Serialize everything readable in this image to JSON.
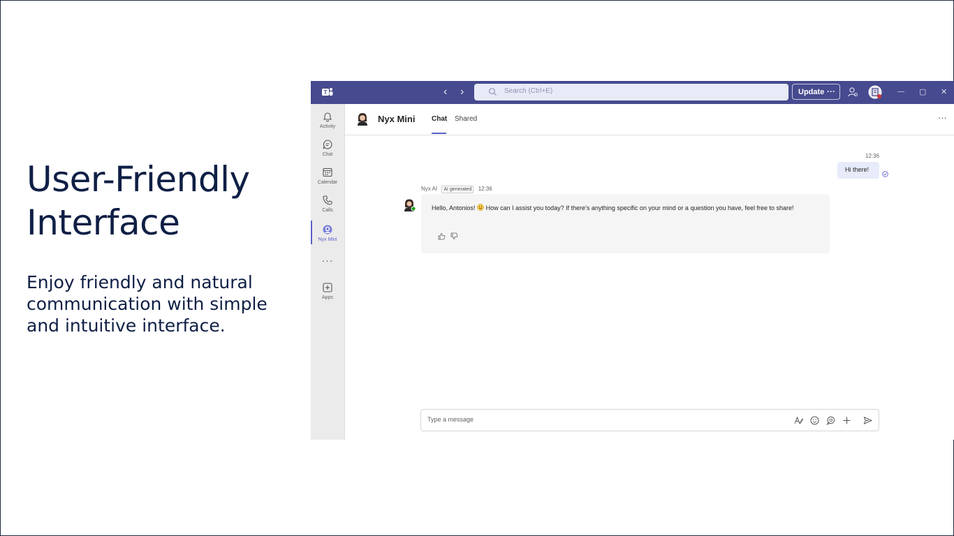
{
  "slide": {
    "title": "User-Friendly Interface",
    "subtitle": "Enjoy friendly and natural communication with simple and intuitive interface."
  },
  "titlebar": {
    "search_placeholder": "Search (Ctrl+E)",
    "update_label": "Update",
    "update_more": "···",
    "back": "‹",
    "forward": "›",
    "minimize": "—",
    "maximize": "▢",
    "close": "✕"
  },
  "rail": {
    "items": [
      {
        "label": "Activity",
        "icon": "bell-icon"
      },
      {
        "label": "Chat",
        "icon": "chat-icon"
      },
      {
        "label": "Calendar",
        "icon": "calendar-icon"
      },
      {
        "label": "Calls",
        "icon": "phone-icon"
      },
      {
        "label": "Nyx Mini",
        "icon": "nyx-mini-icon"
      },
      {
        "label": "Apps",
        "icon": "apps-icon"
      }
    ],
    "more": "···"
  },
  "chat": {
    "name": "Nyx Mini",
    "tabs": [
      {
        "label": "Chat",
        "active": true
      },
      {
        "label": "Shared",
        "active": false
      }
    ],
    "more": "···"
  },
  "messages": {
    "user": {
      "time": "12:36",
      "text": "Hi there!"
    },
    "bot": {
      "sender": "Nyx AI",
      "badge": "AI generated",
      "time": "12:36",
      "text_before": "Hello, Antonios!",
      "text_after": "How can I assist you today? If there's anything specific on your mind or a question you have, feel free to share!"
    }
  },
  "compose": {
    "placeholder": "Type a message"
  },
  "colors": {
    "titlebar": "#464a8e",
    "accent": "#5b5fc7",
    "slide_text": "#0f1f45"
  }
}
